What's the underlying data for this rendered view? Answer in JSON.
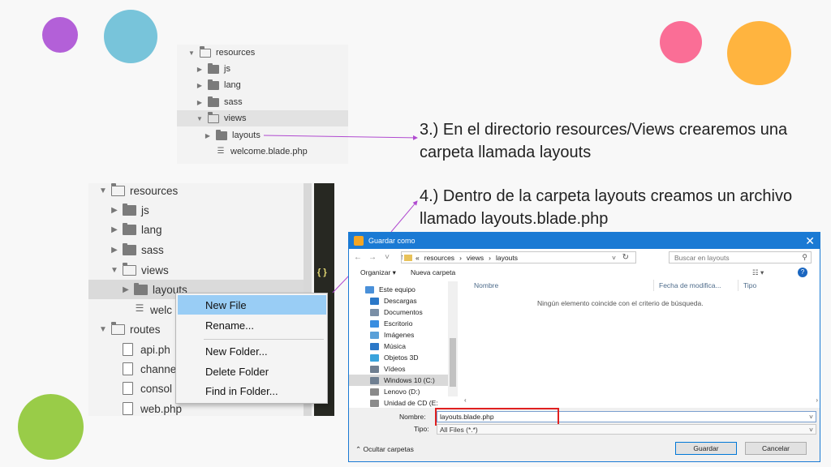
{
  "tree_small": {
    "items": [
      {
        "label": "resources",
        "expanded": true
      },
      {
        "label": "js"
      },
      {
        "label": "lang"
      },
      {
        "label": "sass"
      },
      {
        "label": "views",
        "expanded": true
      },
      {
        "label": "layouts"
      },
      {
        "label": "welcome.blade.php"
      }
    ]
  },
  "tree_large": {
    "items": [
      {
        "label": "resources"
      },
      {
        "label": "js"
      },
      {
        "label": "lang"
      },
      {
        "label": "sass"
      },
      {
        "label": "views"
      },
      {
        "label": "layouts"
      },
      {
        "label": "welc"
      },
      {
        "label": "routes"
      },
      {
        "label": "api.ph"
      },
      {
        "label": "channe"
      },
      {
        "label": "consol"
      },
      {
        "label": "web.php"
      }
    ],
    "editor_glyph": "{ }"
  },
  "context_menu": {
    "items": [
      "New File",
      "Rename...",
      "New Folder...",
      "Delete Folder",
      "Find in Folder..."
    ]
  },
  "instructions": {
    "step3": "3.)  En el directorio resources/Views crearemos una carpeta llamada layouts",
    "step4": "4.) Dentro de la carpeta layouts creamos un archivo llamado layouts.blade.php"
  },
  "dialog": {
    "title": "Guardar como",
    "close": "✕",
    "path": [
      "«",
      "resources",
      "›",
      "views",
      "›",
      "layouts"
    ],
    "search_placeholder": "Buscar en layouts",
    "organize": "Organizar ▾",
    "new_folder": "Nueva carpeta",
    "nav": [
      {
        "label": "Este equipo",
        "color": "#4a90d9"
      },
      {
        "label": "Descargas",
        "color": "#2b78c8"
      },
      {
        "label": "Documentos",
        "color": "#7a8fa6"
      },
      {
        "label": "Escritorio",
        "color": "#3a8ee0"
      },
      {
        "label": "Imágenes",
        "color": "#5aa0d8"
      },
      {
        "label": "Música",
        "color": "#2b78c8"
      },
      {
        "label": "Objetos 3D",
        "color": "#39a3dc"
      },
      {
        "label": "Vídeos",
        "color": "#6f7f91"
      },
      {
        "label": "Windows 10 (C:)",
        "color": "#6f7f91"
      },
      {
        "label": "Lenovo (D:)",
        "color": "#8a8a8a"
      },
      {
        "label": "Unidad de CD (E:",
        "color": "#8a8a8a"
      }
    ],
    "columns": [
      "Nombre",
      "Fecha de modifica...",
      "Tipo"
    ],
    "empty_message": "Ningún elemento coincide con el criterio de búsqueda.",
    "filename_label": "Nombre:",
    "filename_value": "layouts.blade.php",
    "type_label": "Tipo:",
    "type_value": "All Files (*.*)",
    "hide_folders": "Ocultar carpetas",
    "save": "Guardar",
    "cancel": "Cancelar"
  }
}
